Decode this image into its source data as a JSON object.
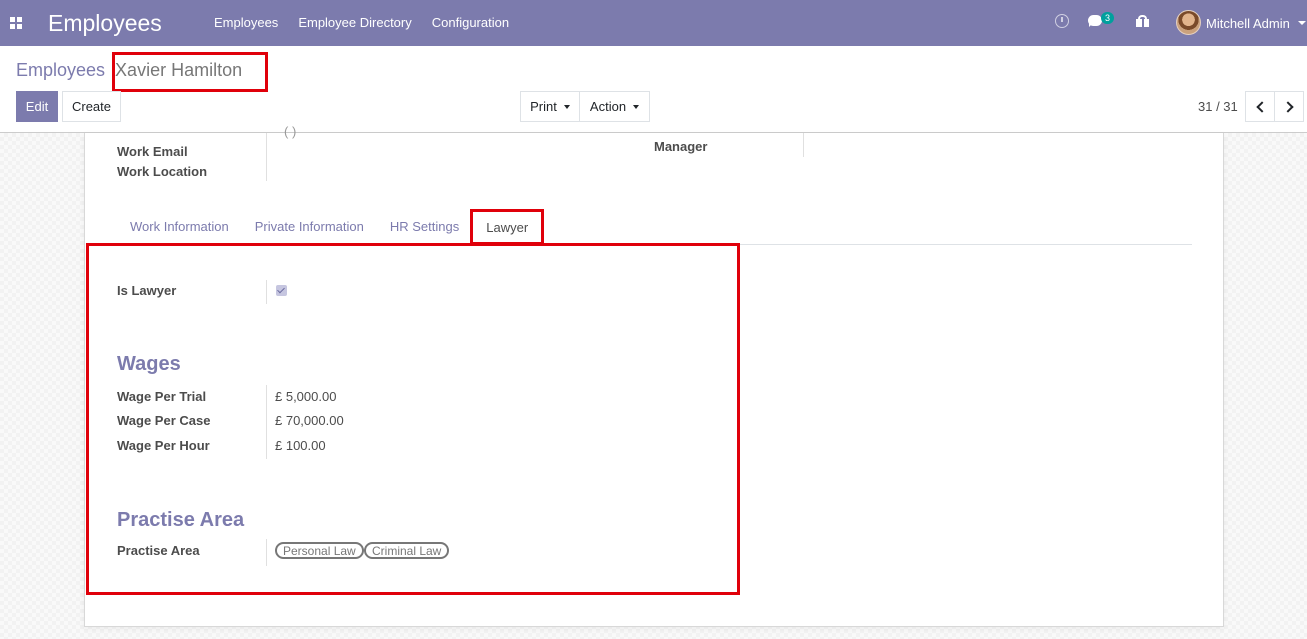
{
  "navbar": {
    "app_title": "Employees",
    "menu": [
      "Employees",
      "Employee Directory",
      "Configuration"
    ],
    "chat_count": "3",
    "user_name": "Mitchell Admin"
  },
  "breadcrumb": {
    "parent": "Employees",
    "current": "Xavier Hamilton"
  },
  "toolbar": {
    "edit_label": "Edit",
    "create_label": "Create",
    "print_label": "Print",
    "action_label": "Action"
  },
  "pager": {
    "value": "31 / 31"
  },
  "form": {
    "partial_text": "(   )",
    "work_email_label": "Work Email",
    "work_location_label": "Work Location",
    "manager_label": "Manager",
    "tabs": [
      "Work Information",
      "Private Information",
      "HR Settings",
      "Lawyer"
    ],
    "active_tab": "Lawyer",
    "lawyer": {
      "is_lawyer_label": "Is Lawyer",
      "is_lawyer": true,
      "wages_title": "Wages",
      "wage_per_trial_label": "Wage Per Trial",
      "wage_per_trial": "£ 5,000.00",
      "wage_per_case_label": "Wage Per Case",
      "wage_per_case": "£ 70,000.00",
      "wage_per_hour_label": "Wage Per Hour",
      "wage_per_hour": "£ 100.00",
      "practise_title": "Practise Area",
      "practise_label": "Practise Area",
      "practise_tags": [
        "Personal Law",
        "Criminal Law"
      ]
    }
  },
  "colors": {
    "brand": "#7c7bad",
    "highlight": "#e0000a",
    "badge": "#00a09d"
  }
}
